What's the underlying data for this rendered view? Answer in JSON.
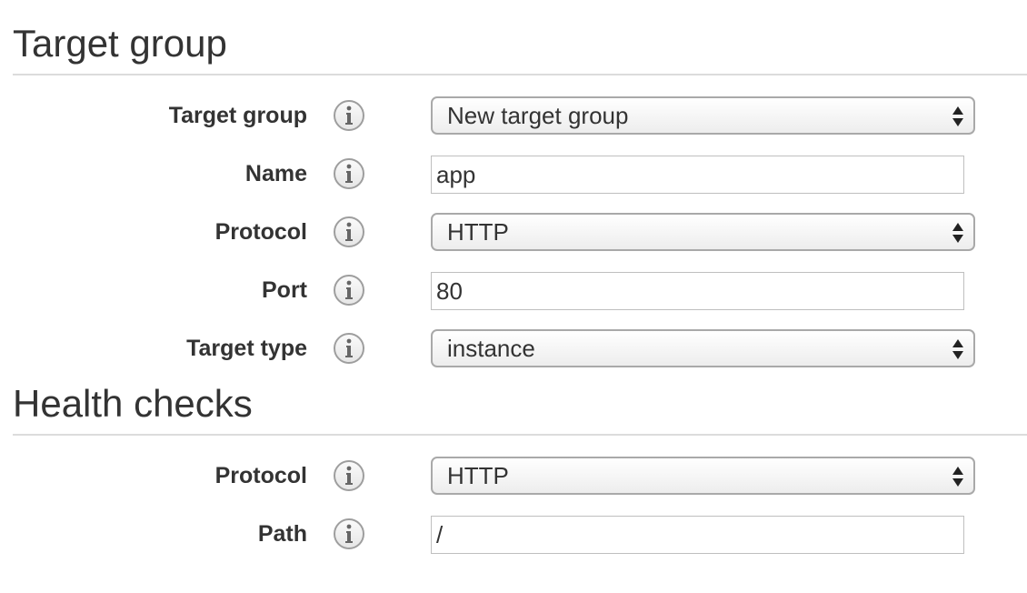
{
  "target_group_section": {
    "title": "Target group",
    "fields": {
      "target_group": {
        "label": "Target group",
        "value": "New target group"
      },
      "name": {
        "label": "Name",
        "value": "app"
      },
      "protocol": {
        "label": "Protocol",
        "value": "HTTP"
      },
      "port": {
        "label": "Port",
        "value": "80"
      },
      "target_type": {
        "label": "Target type",
        "value": "instance"
      }
    }
  },
  "health_checks_section": {
    "title": "Health checks",
    "fields": {
      "protocol": {
        "label": "Protocol",
        "value": "HTTP"
      },
      "path": {
        "label": "Path",
        "value": "/"
      }
    }
  },
  "icons": {
    "info": "info-icon",
    "select_arrows": "updown-arrows-icon"
  },
  "colors": {
    "text": "#333333",
    "divider": "#dcdcdc",
    "control_border": "#a9a9a9",
    "input_border": "#bfbfbf"
  }
}
